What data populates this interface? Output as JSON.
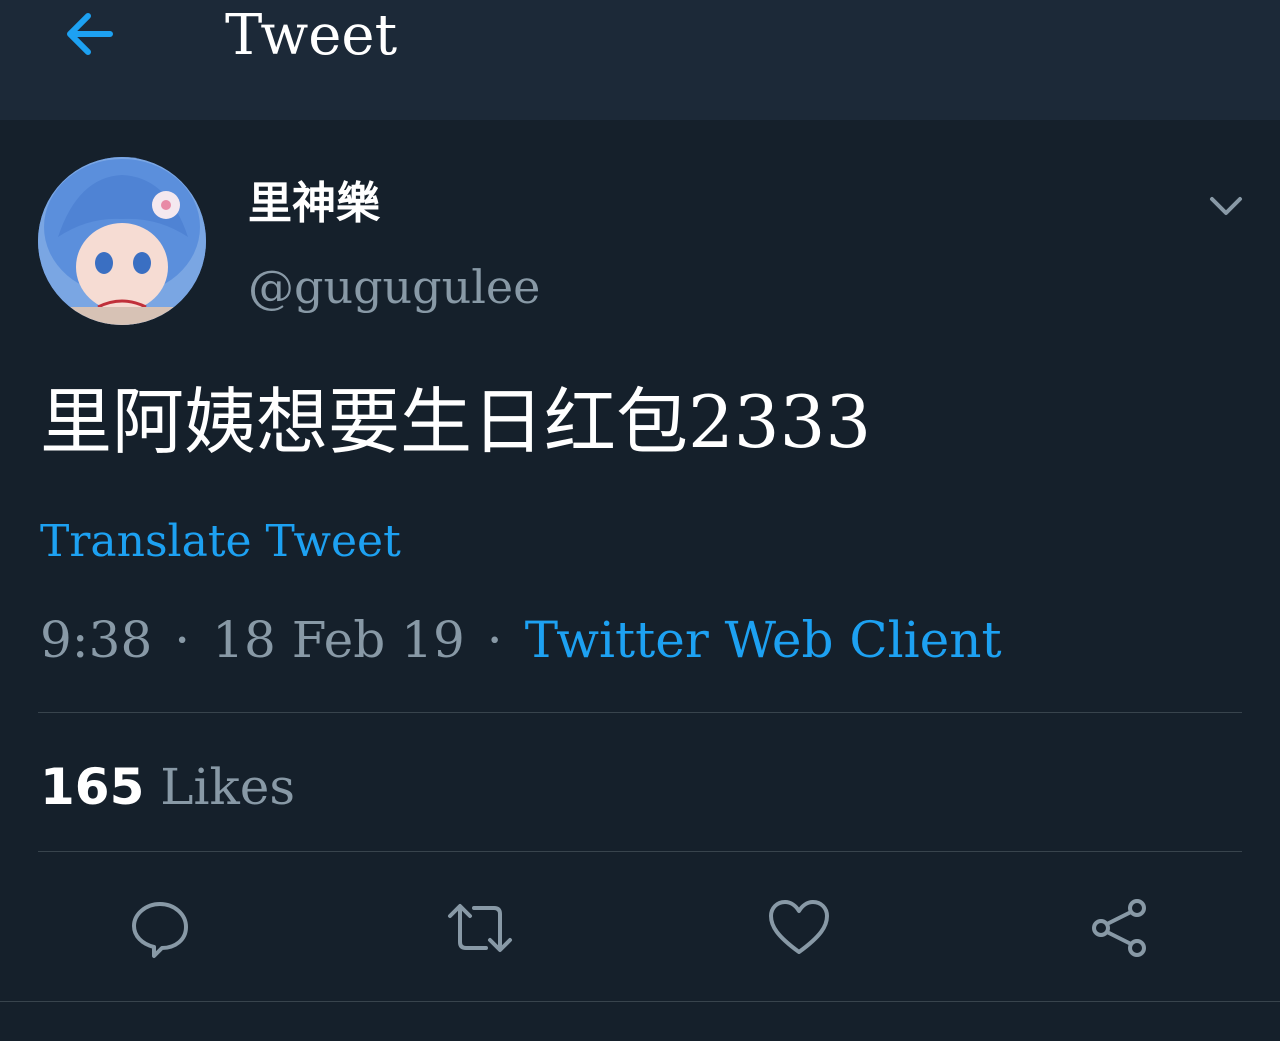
{
  "header": {
    "title": "Tweet",
    "back_icon": "arrow-left-icon"
  },
  "author": {
    "display_name": "里神樂",
    "handle": "@gugugulee",
    "menu_icon": "chevron-down-icon"
  },
  "tweet": {
    "text": "里阿姨想要生日红包2333",
    "translate_label": "Translate Tweet",
    "time": "9:38",
    "date": "18 Feb 19",
    "separator": "·",
    "client": "Twitter Web Client"
  },
  "stats": {
    "likes_count": "165",
    "likes_label": "Likes"
  },
  "actions": [
    {
      "name": "reply",
      "icon": "reply-icon"
    },
    {
      "name": "retweet",
      "icon": "retweet-icon"
    },
    {
      "name": "like",
      "icon": "heart-icon"
    },
    {
      "name": "share",
      "icon": "share-icon"
    }
  ],
  "colors": {
    "background": "#15202b",
    "header_background": "#1c2938",
    "accent": "#1da1f2",
    "secondary_text": "#8899a6",
    "divider": "#38444d"
  }
}
